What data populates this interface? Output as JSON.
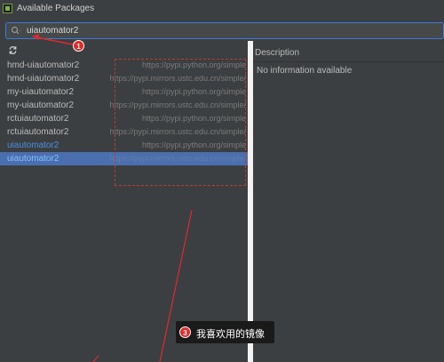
{
  "window": {
    "title": "Available Packages"
  },
  "search": {
    "value": "uiautomator2",
    "icon": "search-icon"
  },
  "toolbar": {
    "refresh_icon": "refresh-icon"
  },
  "packages": [
    {
      "name": "hmd-uiautomator2",
      "repo": "https://pypi.python.org/simple"
    },
    {
      "name": "hmd-uiautomator2",
      "repo": "https://pypi.mirrors.ustc.edu.cn/simple/"
    },
    {
      "name": "my-uiautomator2",
      "repo": "https://pypi.python.org/simple"
    },
    {
      "name": "my-uiautomator2",
      "repo": "https://pypi.mirrors.ustc.edu.cn/simple/"
    },
    {
      "name": "rctuiautomator2",
      "repo": "https://pypi.python.org/simple"
    },
    {
      "name": "rctuiautomator2",
      "repo": "https://pypi.mirrors.ustc.edu.cn/simple/"
    },
    {
      "name": "uiautomator2",
      "repo": "https://pypi.python.org/simple"
    },
    {
      "name": "uiautomator2",
      "repo": "https://pypi.mirrors.ustc.edu.cn/simple/"
    }
  ],
  "description": {
    "header": "Description",
    "body": "No information available"
  },
  "annotations": {
    "badge1": "1",
    "badge3": "3",
    "callout_text": "我喜欢用的镜像",
    "color": "#e02a2a"
  },
  "colors": {
    "background": "#3c3f41",
    "selection": "#4b6eaf",
    "focus_border": "#3d7bd6",
    "link": "#4a90e2"
  }
}
